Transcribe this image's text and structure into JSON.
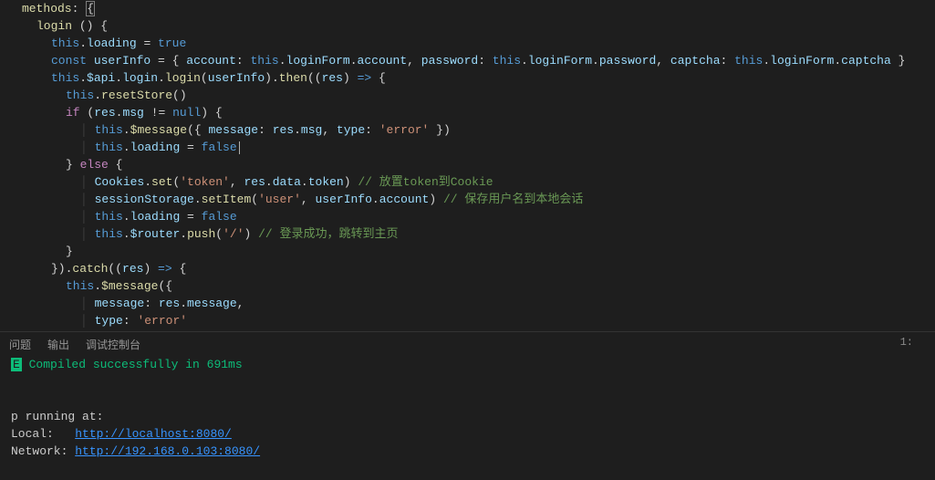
{
  "editor": {
    "lines": {
      "l1a": "methods",
      "l1b": ": ",
      "l1c": "{",
      "l2a": "login",
      " l2b": " () ",
      "l2c": "{",
      "l3a": "this",
      "l3b": ".",
      "l3c": "loading",
      "l3d": " = ",
      "l3e": "true",
      "l4a": "const",
      "l4b": " ",
      "l4c": "userInfo",
      "l4d": " = { ",
      "l4e": "account",
      "l4f": ": ",
      "l4g": "this",
      "l4h": ".",
      "l4i": "loginForm",
      "l4j": ".",
      "l4k": "account",
      "l4l": ", ",
      "l4m": "password",
      "l4n": ": ",
      "l4o": "this",
      "l4p": ".",
      "l4q": "loginForm",
      "l4r": ".",
      "l4s": "password",
      "l4t": ", ",
      "l4u": "captcha",
      "l4v": ": ",
      "l4w": "this",
      "l4x": ".",
      "l4y": "loginForm",
      "l4z": ".",
      "l4za": "captcha",
      "l4zb": " }",
      "l5a": "this",
      "l5b": ".",
      "l5c": "$api",
      "l5d": ".",
      "l5e": "login",
      "l5f": ".",
      "l5g": "login",
      "l5h": "(",
      "l5i": "userInfo",
      "l5j": ").",
      "l5k": "then",
      "l5l": "((",
      "l5m": "res",
      "l5n": ") ",
      "l5o": "=>",
      "l5p": " {",
      "l6a": "this",
      "l6b": ".",
      "l6c": "resetStore",
      "l6d": "()",
      "l7a": "if",
      "l7b": " (",
      "l7c": "res",
      "l7d": ".",
      "l7e": "msg",
      "l7f": " != ",
      "l7g": "null",
      "l7h": ") {",
      "l8a": "this",
      "l8b": ".",
      "l8c": "$message",
      "l8d": "({ ",
      "l8e": "message",
      "l8f": ": ",
      "l8g": "res",
      "l8h": ".",
      "l8i": "msg",
      "l8j": ", ",
      "l8k": "type",
      "l8l": ": ",
      "l8m": "'error'",
      "l8n": " })",
      "l9a": "this",
      "l9b": ".",
      "l9c": "loading",
      "l9d": " = ",
      "l9e": "false",
      "l10a": "} ",
      "l10b": "else",
      "l10c": " {",
      "l11a": "Cookies",
      "l11b": ".",
      "l11c": "set",
      "l11d": "(",
      "l11e": "'token'",
      "l11f": ", ",
      "l11g": "res",
      "l11h": ".",
      "l11i": "data",
      "l11j": ".",
      "l11k": "token",
      "l11l": ") ",
      "l11m": "// 放置token到Cookie",
      "l12a": "sessionStorage",
      "l12b": ".",
      "l12c": "setItem",
      "l12d": "(",
      "l12e": "'user'",
      "l12f": ", ",
      "l12g": "userInfo",
      "l12h": ".",
      "l12i": "account",
      "l12j": ") ",
      "l12k": "// 保存用户名到本地会话",
      "l13a": "this",
      "l13b": ".",
      "l13c": "loading",
      "l13d": " = ",
      "l13e": "false",
      "l14a": "this",
      "l14b": ".",
      "l14c": "$router",
      "l14d": ".",
      "l14e": "push",
      "l14f": "(",
      "l14g": "'/'",
      "l14h": ") ",
      "l14i": "// 登录成功，跳转到主页",
      "l15a": "}",
      "l16a": "}).",
      "l16b": "catch",
      "l16c": "((",
      "l16d": "res",
      "l16e": ") ",
      "l16f": "=>",
      "l16g": " {",
      "l17a": "this",
      "l17b": ".",
      "l17c": "$message",
      "l17d": "({",
      "l18a": "message",
      "l18b": ": ",
      "l18c": "res",
      "l18d": ".",
      "l18e": "message",
      "l18f": ",",
      "l19a": "type",
      "l19b": ": ",
      "l19c": "'error'"
    }
  },
  "tabs": {
    "t1": "问题",
    "t2": "输出",
    "t3": "调试控制台",
    "lineinfo": "1:"
  },
  "terminal": {
    "done": "E",
    "msg": " Compiled successfully in 691ms",
    "run": "p running at:",
    "local_lbl": "Local:   ",
    "local_url": "http://localhost:8080/",
    "net_lbl": "Network: ",
    "net_url": "http://192.168.0.103:8080/"
  }
}
